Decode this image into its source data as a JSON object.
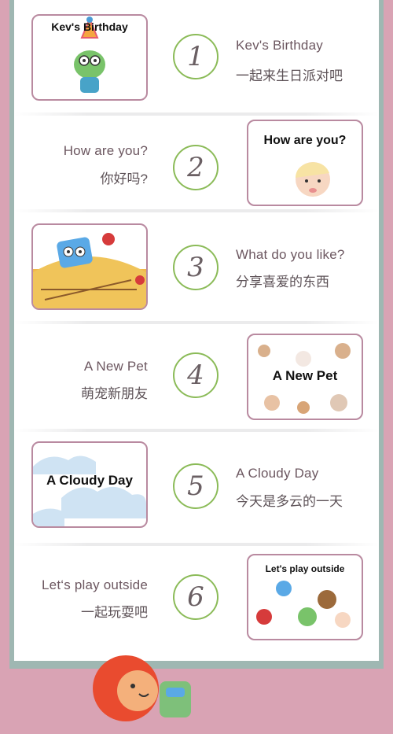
{
  "lessons": [
    {
      "num": "1",
      "card_title": "Kev's Birthday",
      "en": "Kev's Birthday",
      "cn": "一起来生日派对吧"
    },
    {
      "num": "2",
      "card_title": "How are you?",
      "en": "How are you?",
      "cn": "你好吗?"
    },
    {
      "num": "3",
      "card_title": "",
      "en": "What do you like?",
      "cn": "分享喜爱的东西"
    },
    {
      "num": "4",
      "card_title": "A New Pet",
      "en": "A New Pet",
      "cn": "萌宠新朋友"
    },
    {
      "num": "5",
      "card_title": "A Cloudy Day",
      "en": "A Cloudy Day",
      "cn": "今天是多云的一天"
    },
    {
      "num": "6",
      "card_title": "Let's play outside",
      "en": "Let‘s play outside",
      "cn": "一起玩耍吧"
    }
  ],
  "colors": {
    "background": "#d9a3b4",
    "card_border": "#b98aa0",
    "circle": "#8bbb58"
  },
  "icons": [
    "party-hat-frog",
    "baby",
    "bird-in-leaves",
    "pets",
    "clouds",
    "kids-playing",
    "hedgehog-with-backpack"
  ]
}
